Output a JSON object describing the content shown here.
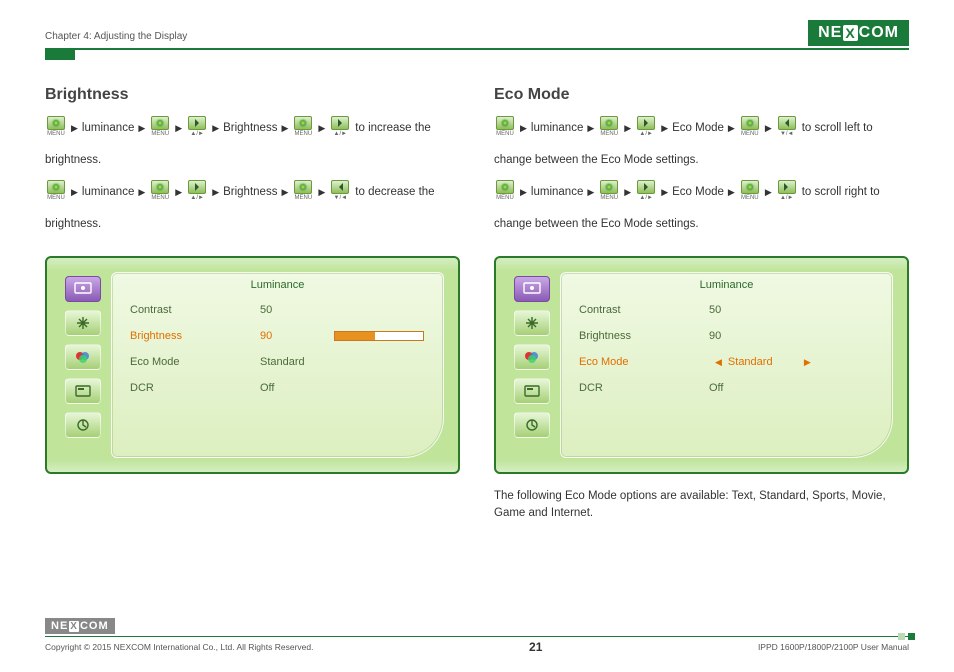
{
  "header": {
    "chapter": "Chapter 4: Adjusting the Display",
    "logo_text_left": "NE",
    "logo_text_x": "X",
    "logo_text_right": "COM"
  },
  "buttons": {
    "menu_caption": "MENU",
    "up_caption": "▲/►",
    "down_caption": "▼/◄"
  },
  "left": {
    "title": "Brightness",
    "step_word_lum": "luminance",
    "step_word_bri": "Brightness",
    "line1_tail": "to increase the",
    "line1_cont": "brightness.",
    "line2_tail": "to decrease the",
    "line2_cont": "brightness.",
    "osd": {
      "title": "Luminance",
      "rows": {
        "contrast_label": "Contrast",
        "contrast_value": "50",
        "brightness_label": "Brightness",
        "brightness_value": "90",
        "eco_label": "Eco Mode",
        "eco_value": "Standard",
        "dcr_label": "DCR",
        "dcr_value": "Off"
      },
      "brightness_pct": 45
    }
  },
  "right": {
    "title": "Eco Mode",
    "step_word_lum": "luminance",
    "step_word_eco": "Eco Mode",
    "line1_tail": "to scroll left to",
    "line1_cont": "change between the Eco Mode settings.",
    "line2_tail": "to scroll right to",
    "line2_cont": "change between the Eco Mode settings.",
    "osd": {
      "title": "Luminance",
      "rows": {
        "contrast_label": "Contrast",
        "contrast_value": "50",
        "brightness_label": "Brightness",
        "brightness_value": "90",
        "eco_label": "Eco Mode",
        "eco_value": "Standard",
        "dcr_label": "DCR",
        "dcr_value": "Off"
      }
    },
    "note": "The following Eco Mode options are available: Text, Standard, Sports, Movie, Game and Internet."
  },
  "footer": {
    "copyright": "Copyright © 2015 NEXCOM International Co., Ltd. All Rights Reserved.",
    "page": "21",
    "manual": "IPPD 1600P/1800P/2100P User Manual"
  }
}
